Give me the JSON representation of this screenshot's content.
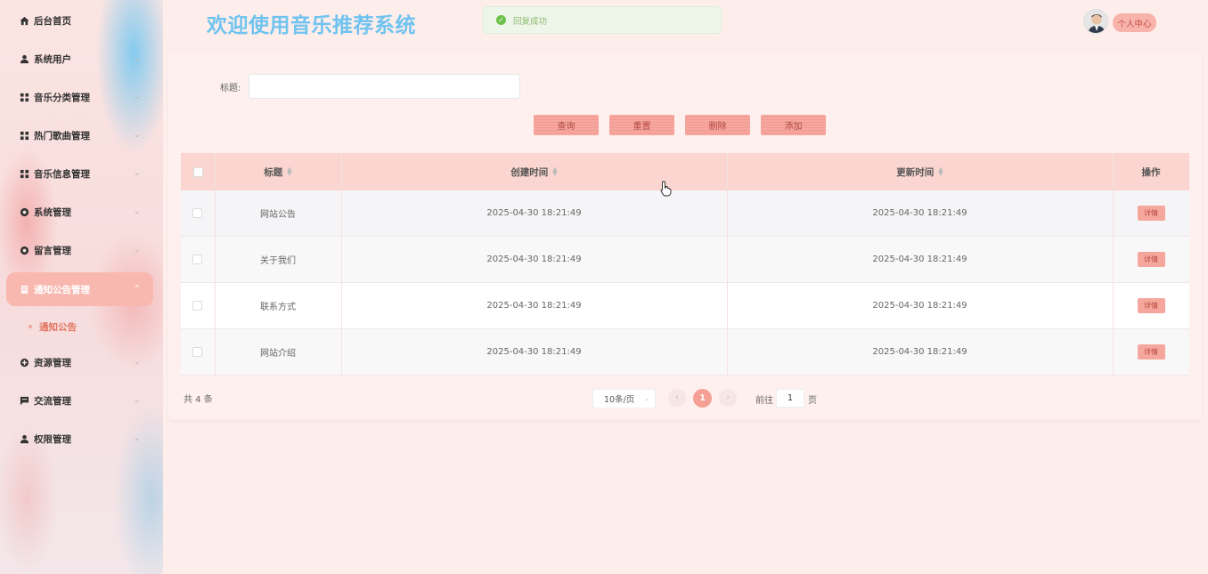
{
  "header": {
    "title": "欢迎使用音乐推荐系统",
    "toast": "回复成功",
    "profile_label": "个人中心"
  },
  "sidebar": {
    "items": [
      {
        "label": "后台首页",
        "icon": "home-icon"
      },
      {
        "label": "系统用户",
        "icon": "user-icon"
      },
      {
        "label": "音乐分类管理",
        "icon": "grid-icon"
      },
      {
        "label": "热门歌曲管理",
        "icon": "grid-icon"
      },
      {
        "label": "音乐信息管理",
        "icon": "grid-icon"
      },
      {
        "label": "系统管理",
        "icon": "gear-icon"
      },
      {
        "label": "留言管理",
        "icon": "gear-icon"
      },
      {
        "label": "通知公告管理",
        "icon": "document-icon"
      },
      {
        "label": "资源管理",
        "icon": "plus-circle-icon"
      },
      {
        "label": "交流管理",
        "icon": "chat-icon"
      },
      {
        "label": "权限管理",
        "icon": "user-icon"
      }
    ],
    "submenu": {
      "label": "通知公告"
    }
  },
  "search": {
    "label": "标题:",
    "value": ""
  },
  "toolbar": {
    "query": "查询",
    "reset": "重置",
    "delete": "删除",
    "add": "添加"
  },
  "table": {
    "columns": [
      "标题",
      "创建时间",
      "更新时间",
      "操作"
    ],
    "rows": [
      {
        "title": "网站公告",
        "created": "2025-04-30 18:21:49",
        "updated": "2025-04-30 18:21:49",
        "action": "详情"
      },
      {
        "title": "关于我们",
        "created": "2025-04-30 18:21:49",
        "updated": "2025-04-30 18:21:49",
        "action": "详情"
      },
      {
        "title": "联系方式",
        "created": "2025-04-30 18:21:49",
        "updated": "2025-04-30 18:21:49",
        "action": "详情"
      },
      {
        "title": "网站介绍",
        "created": "2025-04-30 18:21:49",
        "updated": "2025-04-30 18:21:49",
        "action": "详情"
      }
    ]
  },
  "pagination": {
    "total": "共 4 条",
    "page_size": "10条/页",
    "current_page": "1",
    "goto_label": "前往",
    "goto_value": "1",
    "goto_suffix": "页"
  },
  "colors": {
    "accent": "#f59f95",
    "title": "#70c3ef",
    "header_row": "#fbd6d0"
  }
}
